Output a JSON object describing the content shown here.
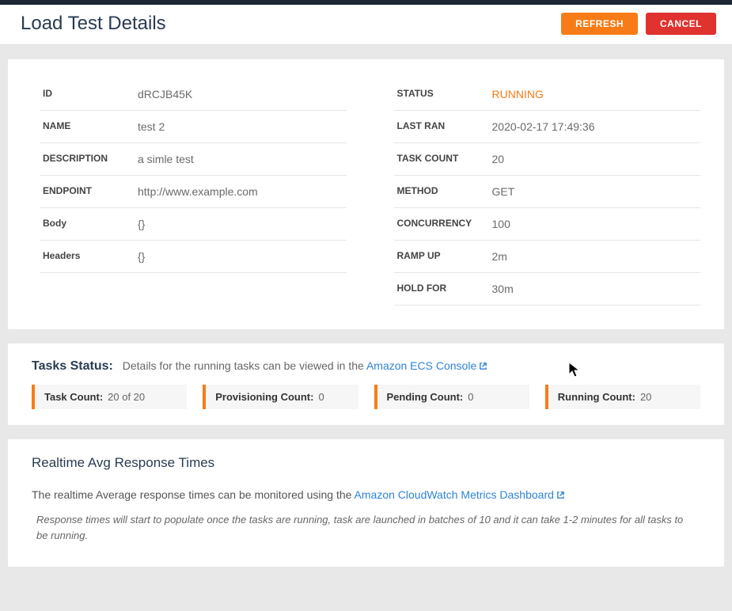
{
  "header": {
    "title": "Load Test Details",
    "refresh_label": "REFRESH",
    "cancel_label": "CANCEL"
  },
  "details_left": [
    {
      "label": "ID",
      "value": "dRCJB45K",
      "upper": true
    },
    {
      "label": "NAME",
      "value": "test 2",
      "upper": true
    },
    {
      "label": "DESCRIPTION",
      "value": "a simle test",
      "upper": true
    },
    {
      "label": "ENDPOINT",
      "value": "http://www.example.com",
      "upper": true
    },
    {
      "label": "Body",
      "value": "{}",
      "upper": false
    },
    {
      "label": "Headers",
      "value": "{}",
      "upper": false
    }
  ],
  "details_right": [
    {
      "label": "STATUS",
      "value": "RUNNING",
      "running": true
    },
    {
      "label": "LAST RAN",
      "value": "2020-02-17 17:49:36"
    },
    {
      "label": "TASK COUNT",
      "value": "20"
    },
    {
      "label": "METHOD",
      "value": "GET"
    },
    {
      "label": "CONCURRENCY",
      "value": "100"
    },
    {
      "label": "RAMP UP",
      "value": "2m"
    },
    {
      "label": "HOLD FOR",
      "value": "30m"
    }
  ],
  "tasks": {
    "title": "Tasks Status:",
    "subtitle_prefix": "Details for the running tasks can be viewed in the ",
    "link_text": "Amazon ECS Console",
    "stats": [
      {
        "label": "Task Count:",
        "value": "20 of 20"
      },
      {
        "label": "Provisioning Count:",
        "value": "0"
      },
      {
        "label": "Pending Count:",
        "value": "0"
      },
      {
        "label": "Running Count:",
        "value": "20"
      }
    ]
  },
  "realtime": {
    "title": "Realtime Avg Response Times",
    "desc_prefix": "The realtime Average response times can be monitored using the ",
    "link_text": "Amazon CloudWatch Metrics Dashboard",
    "note": "Response times will start to populate once the tasks are running, task are launched in batches of 10 and it can take 1-2 minutes for all tasks to be running."
  }
}
